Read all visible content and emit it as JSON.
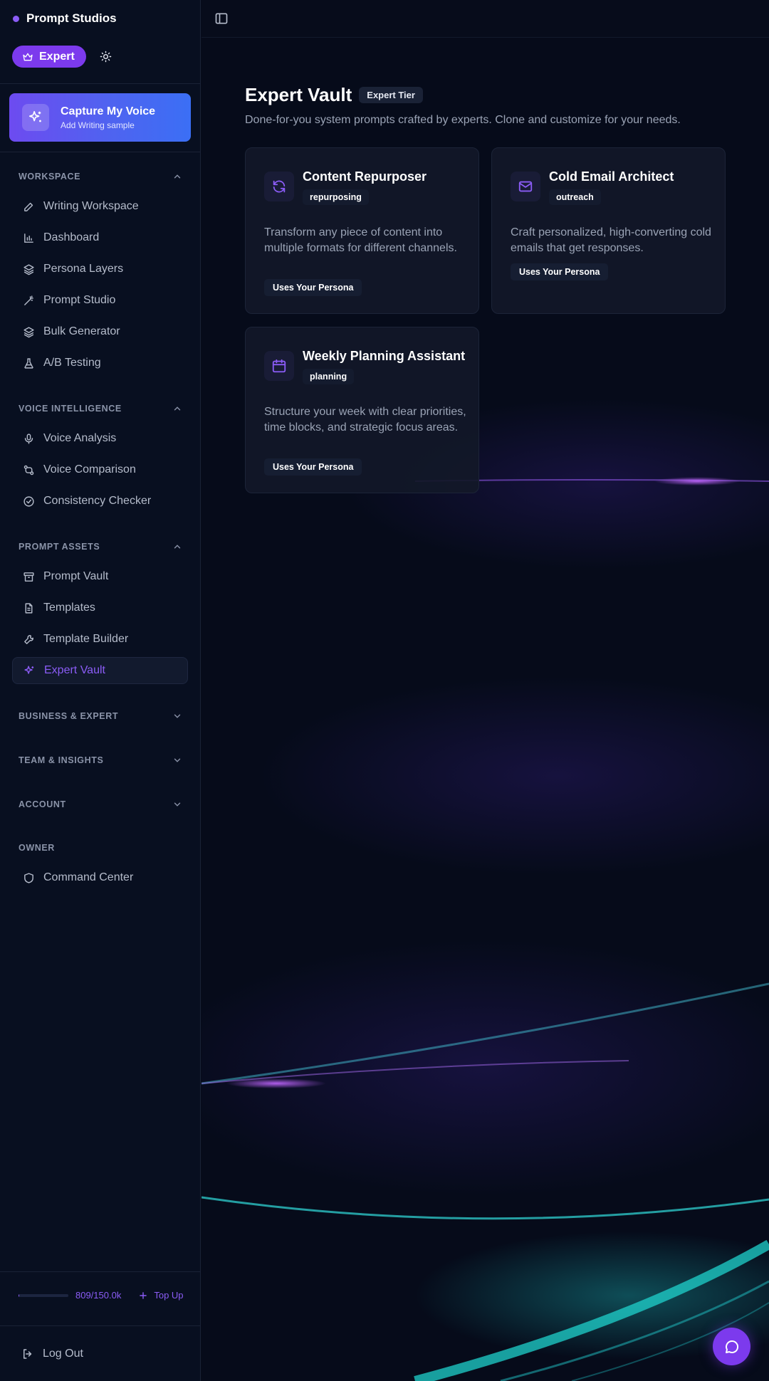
{
  "brand": {
    "name": "Prompt Studios"
  },
  "tier": {
    "label": "Expert"
  },
  "capture": {
    "title": "Capture My Voice",
    "subtitle": "Add Writing sample"
  },
  "sections": {
    "workspace": {
      "label": "WORKSPACE",
      "items": [
        "Writing Workspace",
        "Dashboard",
        "Persona Layers",
        "Prompt Studio",
        "Bulk Generator",
        "A/B Testing"
      ]
    },
    "voice": {
      "label": "VOICE INTELLIGENCE",
      "items": [
        "Voice Analysis",
        "Voice Comparison",
        "Consistency Checker"
      ]
    },
    "assets": {
      "label": "PROMPT ASSETS",
      "items": [
        "Prompt Vault",
        "Templates",
        "Template Builder",
        "Expert Vault"
      ]
    },
    "business": {
      "label": "BUSINESS & EXPERT"
    },
    "team": {
      "label": "TEAM & INSIGHTS"
    },
    "account": {
      "label": "ACCOUNT"
    },
    "owner": {
      "label": "OWNER",
      "items": [
        "Command Center"
      ]
    }
  },
  "credits": {
    "text": "809/150.0k",
    "used": 809,
    "total": 150000,
    "topup_label": "Top Up"
  },
  "logout": {
    "label": "Log Out"
  },
  "page": {
    "title": "Expert Vault",
    "tier_badge": "Expert Tier",
    "subtitle": "Done-for-you system prompts crafted by experts. Clone and customize for your needs."
  },
  "cards": [
    {
      "title": "Content Repurposer",
      "tag": "repurposing",
      "description": "Transform any piece of content into multiple formats for different channels.",
      "badge": "Uses Your Persona",
      "icon": "refresh-icon"
    },
    {
      "title": "Cold Email Architect",
      "tag": "outreach",
      "description": "Craft personalized, high-converting cold emails that get responses.",
      "badge": "Uses Your Persona",
      "icon": "mail-icon"
    },
    {
      "title": "Weekly Planning Assistant",
      "tag": "planning",
      "description": "Structure your week with clear priorities, time blocks, and strategic focus areas.",
      "badge": "Uses Your Persona",
      "icon": "calendar-icon"
    }
  ],
  "colors": {
    "accent": "#7c3aed",
    "accent_light": "#8b5cf6",
    "background": "#060b1a",
    "sidebar": "#080f20"
  }
}
